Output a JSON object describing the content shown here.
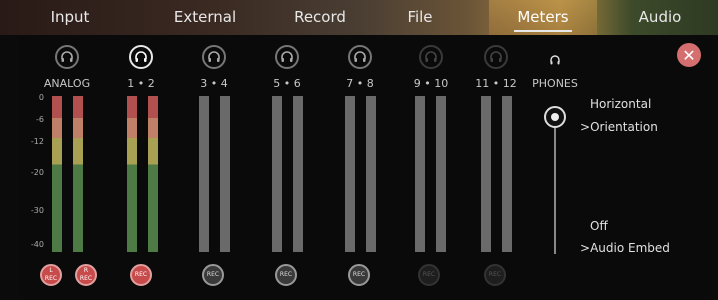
{
  "tabs": [
    {
      "label": "Input"
    },
    {
      "label": "External"
    },
    {
      "label": "Record"
    },
    {
      "label": "File"
    },
    {
      "label": "Meters"
    },
    {
      "label": "Audio"
    }
  ],
  "active_tab": "Meters",
  "channels": [
    {
      "label": "ANALOG"
    },
    {
      "label": "1 • 2"
    },
    {
      "label": "3 • 4"
    },
    {
      "label": "5 • 6"
    },
    {
      "label": "7 • 8"
    },
    {
      "label": "9 • 10"
    },
    {
      "label": "11 • 12"
    }
  ],
  "phones_label": "PHONES",
  "scale": [
    "0",
    "-6",
    "-12",
    "-20",
    "-30",
    "-40"
  ],
  "rec_labels": {
    "l": "L",
    "r": "R",
    "rec": "REC"
  },
  "orientation": {
    "value": "Horizontal",
    "label": "Orientation"
  },
  "audio_embed": {
    "value": "Off",
    "label": "Audio Embed"
  },
  "close_symbol": "✕",
  "chevron": ">",
  "colors": {
    "accent_red": "#c74b4b",
    "meter_green": "#4e7a45",
    "meter_yellow": "#a8a053",
    "meter_red": "#b25050"
  }
}
